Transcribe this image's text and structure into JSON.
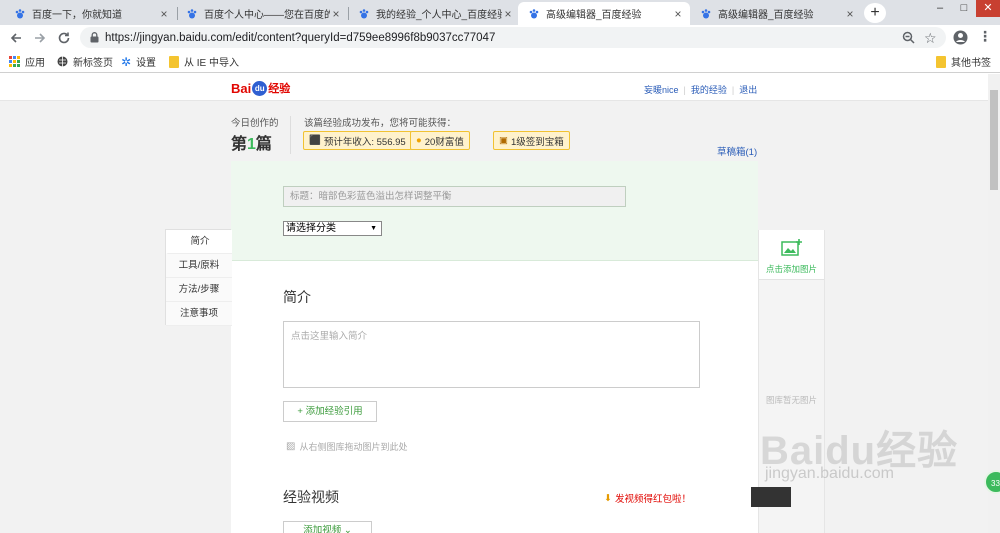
{
  "browser": {
    "tabs": [
      {
        "title": "百度一下，你就知道",
        "active": false
      },
      {
        "title": "百度个人中心——您在百度的家",
        "active": false
      },
      {
        "title": "我的经验_个人中心_百度经验",
        "active": false
      },
      {
        "title": "高级编辑器_百度经验",
        "active": true
      },
      {
        "title": "高级编辑器_百度经验",
        "active": false
      }
    ],
    "close_glyph": "×",
    "new_tab_glyph": "+",
    "window_controls": [
      "–",
      "□",
      "✕"
    ],
    "url": "https://jingyan.baidu.com/edit/content?queryId=d759ee8996f8b9037cc77047",
    "bookmarks": [
      {
        "label": "应用",
        "icon": "apps-grid-icon"
      },
      {
        "label": "新标签页",
        "icon": "globe-icon"
      },
      {
        "label": "设置",
        "icon": "gear-icon"
      },
      {
        "label": "从 IE 中导入",
        "icon": "folder-icon"
      }
    ],
    "other_bookmarks": "其他书签"
  },
  "header": {
    "logo_bai": "Bai",
    "logo_du": "du",
    "logo_jy": "经验",
    "user_link": "妄暖nice",
    "my_exp_link": "我的经验",
    "logout_link": "退出"
  },
  "stats": {
    "today_label": "今日创作的",
    "count_prefix": "第",
    "count": "1",
    "count_suffix": "篇",
    "reward_hint": "该篇经验成功发布，您将可能获得：",
    "income": "预计年收入: 556.95",
    "wealth": "20财富值",
    "signin": "1级签到宝箱",
    "drafts": "草稿箱(1)"
  },
  "editor": {
    "title_placeholder": "标题：暗部色彩蓝色溢出怎样调整平衡",
    "category": "请选择分类",
    "intro_heading": "简介",
    "intro_placeholder": "点击这里输入简介",
    "add_ref": "+ 添加经验引用",
    "drag_hint": "从右侧图库拖动图片到此处",
    "video_heading": "经验视频",
    "video_promo": "发视频得红包啦！",
    "add_video": "添加视频 ⌄"
  },
  "sidenav": [
    "简介",
    "工具/原料",
    "方法/步骤",
    "注意事项"
  ],
  "gallery": {
    "add_image": "点击添加图片",
    "empty": "图库暂无图片"
  },
  "floating": {
    "chat_count": "33"
  },
  "watermark": {
    "line1": "Bai",
    "line1b": "du",
    "line1c": "经验",
    "line2": "jingyan.baidu.com"
  },
  "colors": {
    "accent_green": "#3cba5c",
    "link_blue": "#2b5db8",
    "logo_red": "#e10601"
  }
}
